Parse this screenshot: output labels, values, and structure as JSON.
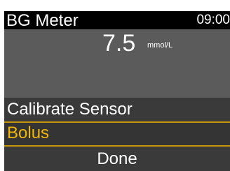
{
  "header": {
    "title": "BG Meter",
    "time": "09:00"
  },
  "reading": {
    "value": "7.5",
    "unit": "mmol/L"
  },
  "menu": {
    "items": [
      {
        "label": "Calibrate Sensor",
        "selected": false
      },
      {
        "label": "Bolus",
        "selected": true
      },
      {
        "label": "Done",
        "selected": false
      }
    ]
  },
  "colors": {
    "background": "#000000",
    "reading_panel": "#5b5b5b",
    "menu_item": "#3a3a3a",
    "selection_accent": "#f2b705",
    "text": "#ffffff"
  }
}
